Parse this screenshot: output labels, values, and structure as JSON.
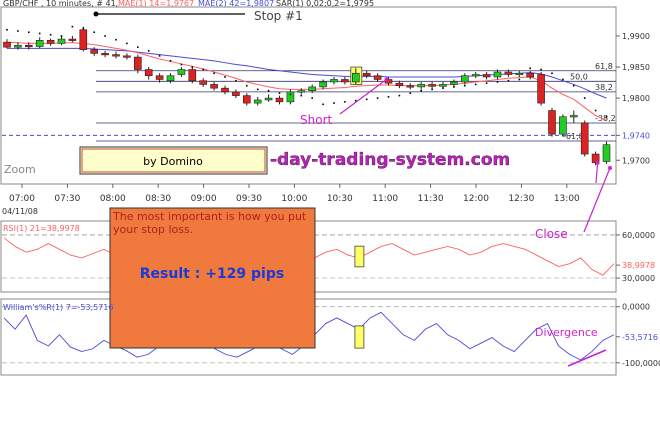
{
  "header": {
    "text": "GBP/CHF , 10 minutes, # 41,",
    "mae1": "MAE(1) 14=1,9767",
    "mae2": "MAE(2) 42=1,9807",
    "sar": "SAR(1) 0,02;0,2=1,9795",
    "stop": "Stop #1"
  },
  "colors": {
    "ma_fast": "#ff6060",
    "ma_slow": "#4a4ad8",
    "bull": "#22cc22",
    "bear": "#dd2222",
    "annotation": "#cc22cc",
    "rsi": "#ff6060",
    "williams": "#4a4ad8",
    "note_bg": "#f07a3e",
    "result_text": "#1a3ad8",
    "note_text": "#b02020",
    "badge_bg": "#ffffcc",
    "watermark": "#bb22bb"
  },
  "annotations": {
    "short": "Short",
    "close": "Close",
    "divergence": "Divergence",
    "zoom": "Zoom",
    "badge": "by Domino",
    "watermark": "-day-trading-system.com",
    "note": "The most important is how you put your stop loss.",
    "result": "Result : +129 pips"
  },
  "fib_labels": {
    "f618_top": "61,8",
    "f500": "50,0",
    "f382_top": "38,2",
    "f382_low": "-38,2",
    "f618_low": "-61,8"
  },
  "chart_data": [
    {
      "type": "candlestick",
      "x_labels": [
        "07:00",
        "07:30",
        "08:00",
        "08:30",
        "09:00",
        "09:30",
        "10:00",
        "10:30",
        "11:00",
        "11:30",
        "12:00",
        "12:30",
        "13:00"
      ],
      "date_label": "04/11/08",
      "y_ticks": [
        "1,9900",
        "1,9850",
        "1,9800",
        "1,9740",
        "1,9700"
      ],
      "y_tick_values": [
        1.99,
        1.985,
        1.98,
        1.974,
        1.97
      ],
      "ylim": [
        1.9665,
        1.9945
      ],
      "highlight_price": "1,9740",
      "candles": [
        [
          1.989,
          1.9882,
          1.9895,
          1.988
        ],
        [
          1.9882,
          1.9885,
          1.989,
          1.9878
        ],
        [
          1.9885,
          1.9883,
          1.989,
          1.9878
        ],
        [
          1.9883,
          1.9893,
          1.9898,
          1.988
        ],
        [
          1.9893,
          1.9888,
          1.9896,
          1.9884
        ],
        [
          1.9888,
          1.9895,
          1.99,
          1.9885
        ],
        [
          1.9895,
          1.9893,
          1.99,
          1.989
        ],
        [
          1.991,
          1.9878,
          1.9915,
          1.9875
        ],
        [
          1.9878,
          1.9872,
          1.9882,
          1.9868
        ],
        [
          1.9872,
          1.987,
          1.9876,
          1.9866
        ],
        [
          1.987,
          1.9868,
          1.9875,
          1.9864
        ],
        [
          1.9868,
          1.9866,
          1.9872,
          1.9862
        ],
        [
          1.9866,
          1.9846,
          1.987,
          1.984
        ],
        [
          1.9846,
          1.9836,
          1.985,
          1.983
        ],
        [
          1.9836,
          1.983,
          1.984,
          1.9825
        ],
        [
          1.9828,
          1.9836,
          1.984,
          1.9824
        ],
        [
          1.9838,
          1.9846,
          1.985,
          1.9834
        ],
        [
          1.9846,
          1.9828,
          1.985,
          1.9824
        ],
        [
          1.9828,
          1.9822,
          1.9832,
          1.9818
        ],
        [
          1.9822,
          1.9816,
          1.9826,
          1.9812
        ],
        [
          1.9816,
          1.981,
          1.982,
          1.9806
        ],
        [
          1.981,
          1.9804,
          1.9814,
          1.98
        ],
        [
          1.9804,
          1.9792,
          1.9808,
          1.9788
        ],
        [
          1.9792,
          1.9797,
          1.9802,
          1.9788
        ],
        [
          1.9797,
          1.98,
          1.9806,
          1.9794
        ],
        [
          1.98,
          1.9794,
          1.9804,
          1.979
        ],
        [
          1.9794,
          1.981,
          1.9814,
          1.979
        ],
        [
          1.981,
          1.9812,
          1.9816,
          1.9806
        ],
        [
          1.9812,
          1.9818,
          1.9822,
          1.9808
        ],
        [
          1.9818,
          1.9826,
          1.983,
          1.9814
        ],
        [
          1.9826,
          1.983,
          1.9834,
          1.9822
        ],
        [
          1.983,
          1.9826,
          1.9834,
          1.9822
        ],
        [
          1.9826,
          1.984,
          1.9848,
          1.9822
        ],
        [
          1.984,
          1.9836,
          1.9844,
          1.9832
        ],
        [
          1.9836,
          1.983,
          1.984,
          1.9826
        ],
        [
          1.983,
          1.9824,
          1.9834,
          1.982
        ],
        [
          1.9824,
          1.982,
          1.9828,
          1.9816
        ],
        [
          1.982,
          1.9818,
          1.9824,
          1.9814
        ],
        [
          1.9818,
          1.9822,
          1.9826,
          1.9814
        ],
        [
          1.9822,
          1.9819,
          1.9826,
          1.9815
        ],
        [
          1.9819,
          1.9822,
          1.9826,
          1.9815
        ],
        [
          1.9822,
          1.9826,
          1.983,
          1.9818
        ],
        [
          1.9826,
          1.9836,
          1.984,
          1.9822
        ],
        [
          1.9836,
          1.9838,
          1.9842,
          1.9832
        ],
        [
          1.9838,
          1.9834,
          1.9842,
          1.983
        ],
        [
          1.9834,
          1.9842,
          1.9846,
          1.983
        ],
        [
          1.9842,
          1.9838,
          1.9846,
          1.9834
        ],
        [
          1.9838,
          1.984,
          1.9844,
          1.9834
        ],
        [
          1.984,
          1.9834,
          1.9844,
          1.983
        ],
        [
          1.9838,
          1.9792,
          1.9842,
          1.9788
        ],
        [
          1.978,
          1.9742,
          1.9784,
          1.9738
        ],
        [
          1.9742,
          1.977,
          1.9774,
          1.9738
        ],
        [
          1.977,
          1.9772,
          1.978,
          1.976
        ],
        [
          1.976,
          1.971,
          1.9764,
          1.9706
        ],
        [
          1.971,
          1.9696,
          1.9714,
          1.9692
        ],
        [
          1.9698,
          1.9725,
          1.973,
          1.9694
        ]
      ],
      "ma_fast": [
        1.989,
        1.9889,
        1.9888,
        1.9888,
        1.9888,
        1.9889,
        1.9889,
        1.9888,
        1.9886,
        1.9883,
        1.988,
        1.9877,
        1.9873,
        1.9868,
        1.9863,
        1.9859,
        1.9855,
        1.9851,
        1.9847,
        1.9842,
        1.9837,
        1.9832,
        1.9826,
        1.9822,
        1.9818,
        1.9815,
        1.9814,
        1.9814,
        1.9814,
        1.9815,
        1.9816,
        1.9817,
        1.9819,
        1.982,
        1.9821,
        1.9821,
        1.982,
        1.982,
        1.982,
        1.982,
        1.9821,
        1.9822,
        1.9824,
        1.9826,
        1.9828,
        1.983,
        1.9832,
        1.9833,
        1.9834,
        1.9828,
        1.9816,
        1.9806,
        1.9798,
        1.9785,
        1.9772,
        1.9764
      ],
      "ma_slow": [
        1.988,
        1.988,
        1.988,
        1.988,
        1.988,
        1.988,
        1.988,
        1.988,
        1.9879,
        1.9878,
        1.9877,
        1.9876,
        1.9874,
        1.9872,
        1.987,
        1.9868,
        1.9866,
        1.9864,
        1.9862,
        1.986,
        1.9857,
        1.9854,
        1.9852,
        1.9849,
        1.9846,
        1.9844,
        1.9842,
        1.984,
        1.9838,
        1.9837,
        1.9836,
        1.9835,
        1.9835,
        1.9835,
        1.9835,
        1.9834,
        1.9834,
        1.9834,
        1.9834,
        1.9834,
        1.9834,
        1.9834,
        1.9835,
        1.9836,
        1.9837,
        1.9838,
        1.9839,
        1.984,
        1.9841,
        1.9839,
        1.9834,
        1.9828,
        1.9822,
        1.9815,
        1.9807,
        1.98
      ],
      "sar": [
        1.991,
        1.9908,
        1.9906,
        1.9904,
        1.9902,
        1.99,
        1.9915,
        1.9912,
        1.9906,
        1.99,
        1.9894,
        1.9888,
        1.9882,
        1.9876,
        1.9868,
        1.986,
        1.9854,
        1.985,
        1.9846,
        1.984,
        1.9834,
        1.9828,
        1.982,
        1.9814,
        1.9812,
        1.9808,
        1.9806,
        1.9804,
        1.98,
        1.979,
        1.9792,
        1.9794,
        1.9796,
        1.9798,
        1.98,
        1.9802,
        1.9804,
        1.9808,
        1.9812,
        1.9814,
        1.9816,
        1.9818,
        1.982,
        1.9822,
        1.9824,
        1.9826,
        1.9828,
        1.983,
        1.9848,
        1.9846,
        1.984,
        1.983,
        1.982,
        1.98,
        1.978,
        1.977
      ],
      "fib_levels": [
        1.9844,
        1.9827,
        1.981,
        1.976,
        1.9731
      ],
      "highlight_candle": 32,
      "short_candle": 35,
      "close_candle": 54
    },
    {
      "type": "line",
      "title": "RSI(1) 21=38,9978",
      "y_ticks": [
        "60,0000",
        "38,9978",
        "30,0000"
      ],
      "y_tick_values": [
        60,
        38.9978,
        30
      ],
      "ylim": [
        21,
        69
      ],
      "values": [
        58,
        52,
        48,
        50,
        54,
        50,
        46,
        44,
        47,
        50,
        46,
        42,
        44,
        40,
        38,
        42,
        46,
        44,
        40,
        36,
        34,
        36,
        40,
        44,
        46,
        44,
        42,
        40,
        44,
        48,
        50,
        46,
        44,
        48,
        52,
        54,
        50,
        46,
        48,
        50,
        52,
        50,
        46,
        48,
        52,
        54,
        52,
        50,
        46,
        42,
        38,
        40,
        44,
        36,
        32,
        40
      ]
    },
    {
      "type": "line",
      "title": "William's%R(1) 7=-53,5716",
      "y_ticks": [
        "0,0000",
        "-53,5716",
        "-100,0000"
      ],
      "y_tick_values": [
        0,
        -53.5716,
        -100
      ],
      "ylim": [
        -120,
        12
      ],
      "values": [
        -20,
        -40,
        -15,
        -60,
        -70,
        -50,
        -72,
        -80,
        -75,
        -60,
        -70,
        -78,
        -90,
        -85,
        -70,
        -60,
        -65,
        -40,
        -60,
        -75,
        -85,
        -90,
        -80,
        -70,
        -60,
        -75,
        -85,
        -70,
        -50,
        -30,
        -20,
        -30,
        -40,
        -20,
        -10,
        -30,
        -50,
        -60,
        -40,
        -30,
        -50,
        -60,
        -75,
        -65,
        -55,
        -70,
        -80,
        -60,
        -40,
        -30,
        -70,
        -85,
        -95,
        -80,
        -60,
        -50
      ]
    }
  ]
}
